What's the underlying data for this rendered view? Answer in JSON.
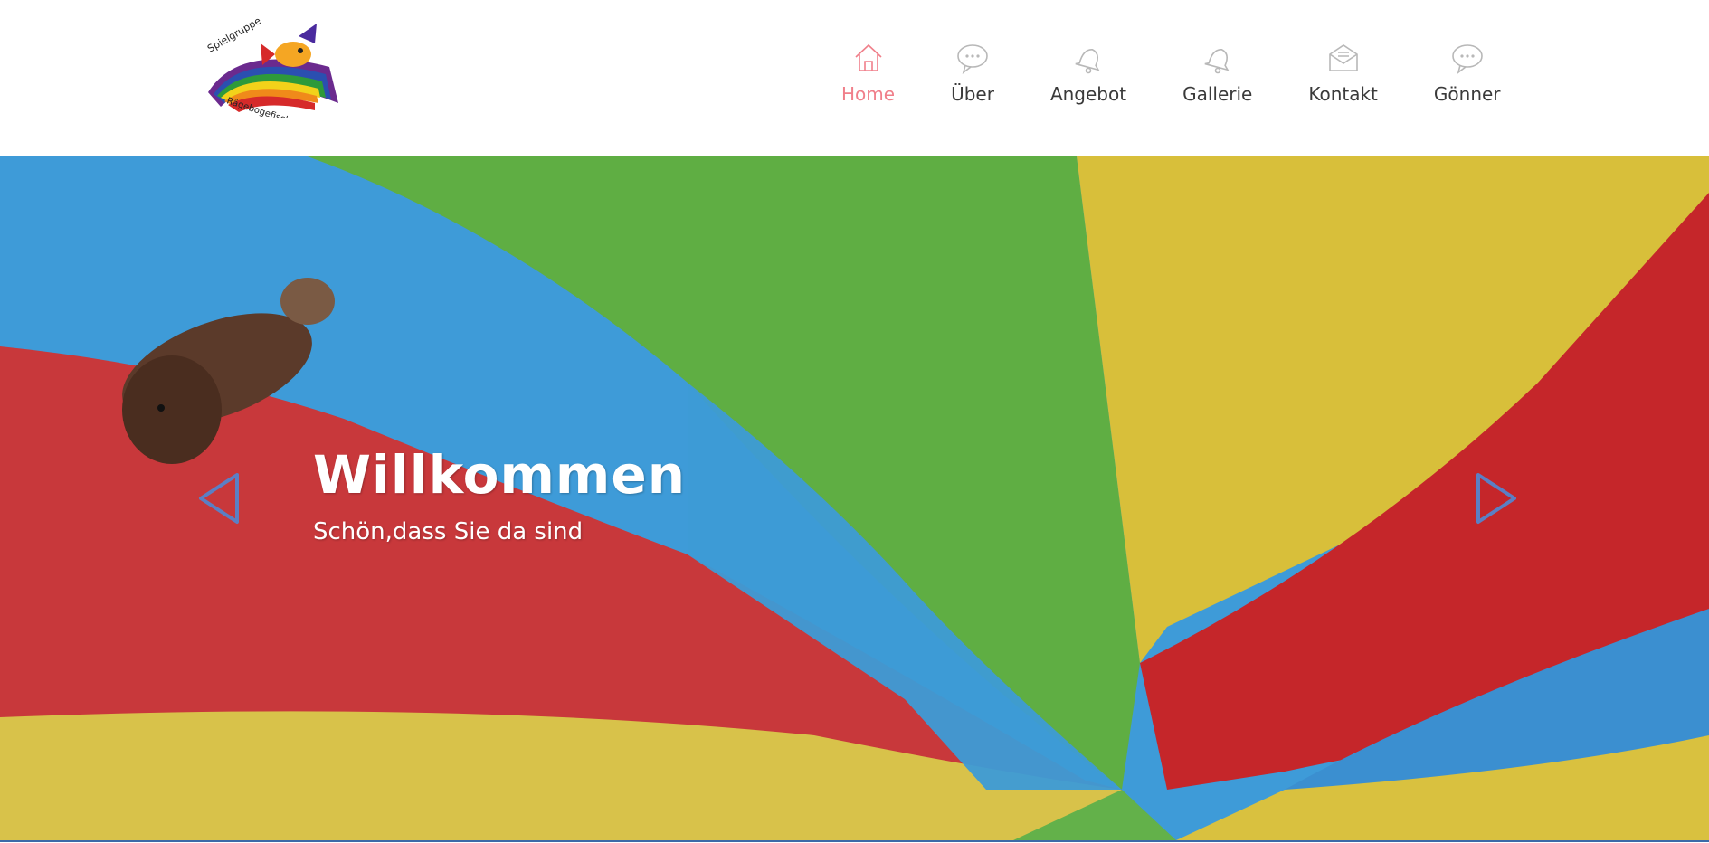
{
  "logo": {
    "text_top": "Spielgruppe",
    "text_bottom": "Rägebogefisch"
  },
  "nav": {
    "items": [
      {
        "label": "Home",
        "icon": "house-icon",
        "active": true
      },
      {
        "label": "Über",
        "icon": "speech-bubble-icon",
        "active": false
      },
      {
        "label": "Angebot",
        "icon": "bell-icon",
        "active": false
      },
      {
        "label": "Gallerie",
        "icon": "bell-icon",
        "active": false
      },
      {
        "label": "Kontakt",
        "icon": "envelope-icon",
        "active": false
      },
      {
        "label": "Gönner",
        "icon": "speech-bubble-icon",
        "active": false
      }
    ],
    "active_color": "#f07f8a",
    "icon_color": "#b8b8b8"
  },
  "hero": {
    "title": "Willkommen",
    "subtitle": "Schön,dass Sie da sind",
    "prev_icon": "triangle-left-icon",
    "next_icon": "triangle-right-icon",
    "arrow_color": "#5b7fc4"
  }
}
